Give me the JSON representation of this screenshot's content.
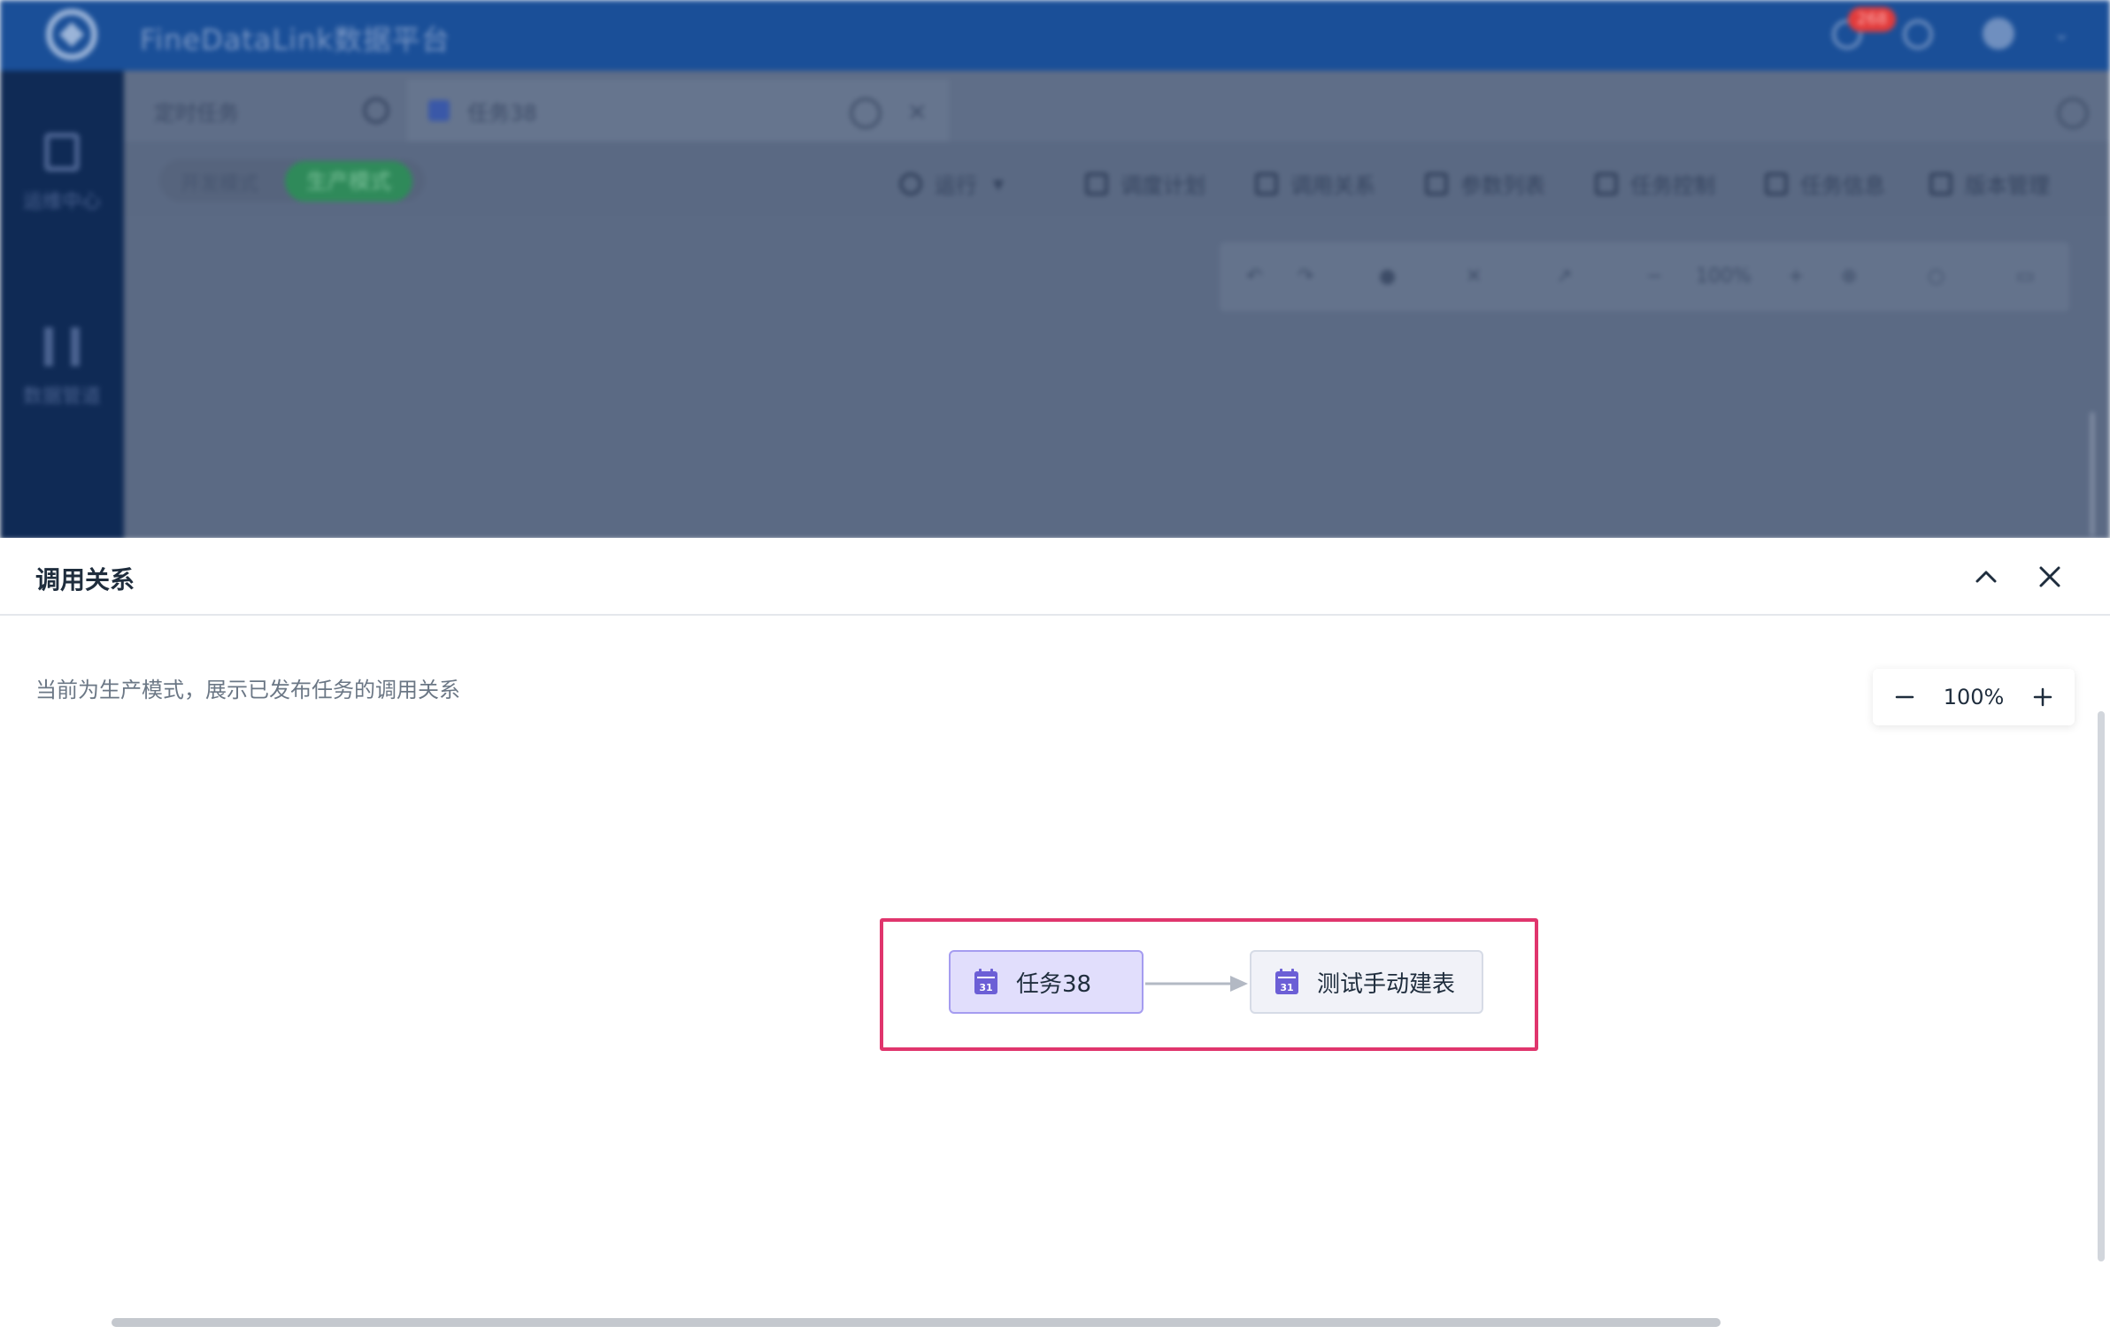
{
  "app": {
    "title": "FineDataLink数据平台",
    "notification_count": "268"
  },
  "sidenav": {
    "items": [
      {
        "label": "运维中心"
      },
      {
        "label": "数据管道"
      }
    ]
  },
  "tabs": [
    {
      "label": "定时任务",
      "active": false
    },
    {
      "label": "任务38",
      "active": true
    }
  ],
  "toolbar": {
    "mode_dev": "开发模式",
    "mode_prod": "生产模式",
    "items": [
      {
        "label": "运行"
      },
      {
        "label": "调度计划"
      },
      {
        "label": "调用关系"
      },
      {
        "label": "参数列表"
      },
      {
        "label": "任务控制"
      },
      {
        "label": "任务信息"
      },
      {
        "label": "版本管理"
      }
    ],
    "canvas_zoom": "100%"
  },
  "panel": {
    "title": "调用关系",
    "hint": "当前为生产模式，展示已发布任务的调用关系",
    "zoom": "100%",
    "nodes": [
      {
        "label": "任务38",
        "selected": true
      },
      {
        "label": "测试手动建表",
        "selected": false
      }
    ]
  },
  "colors": {
    "highlight": "#e0356d",
    "selected_node_bg": "#e1defc",
    "node_icon": "#6c5fd6",
    "header_blue": "#1a4f98",
    "prod_green": "#2f8a5a"
  }
}
